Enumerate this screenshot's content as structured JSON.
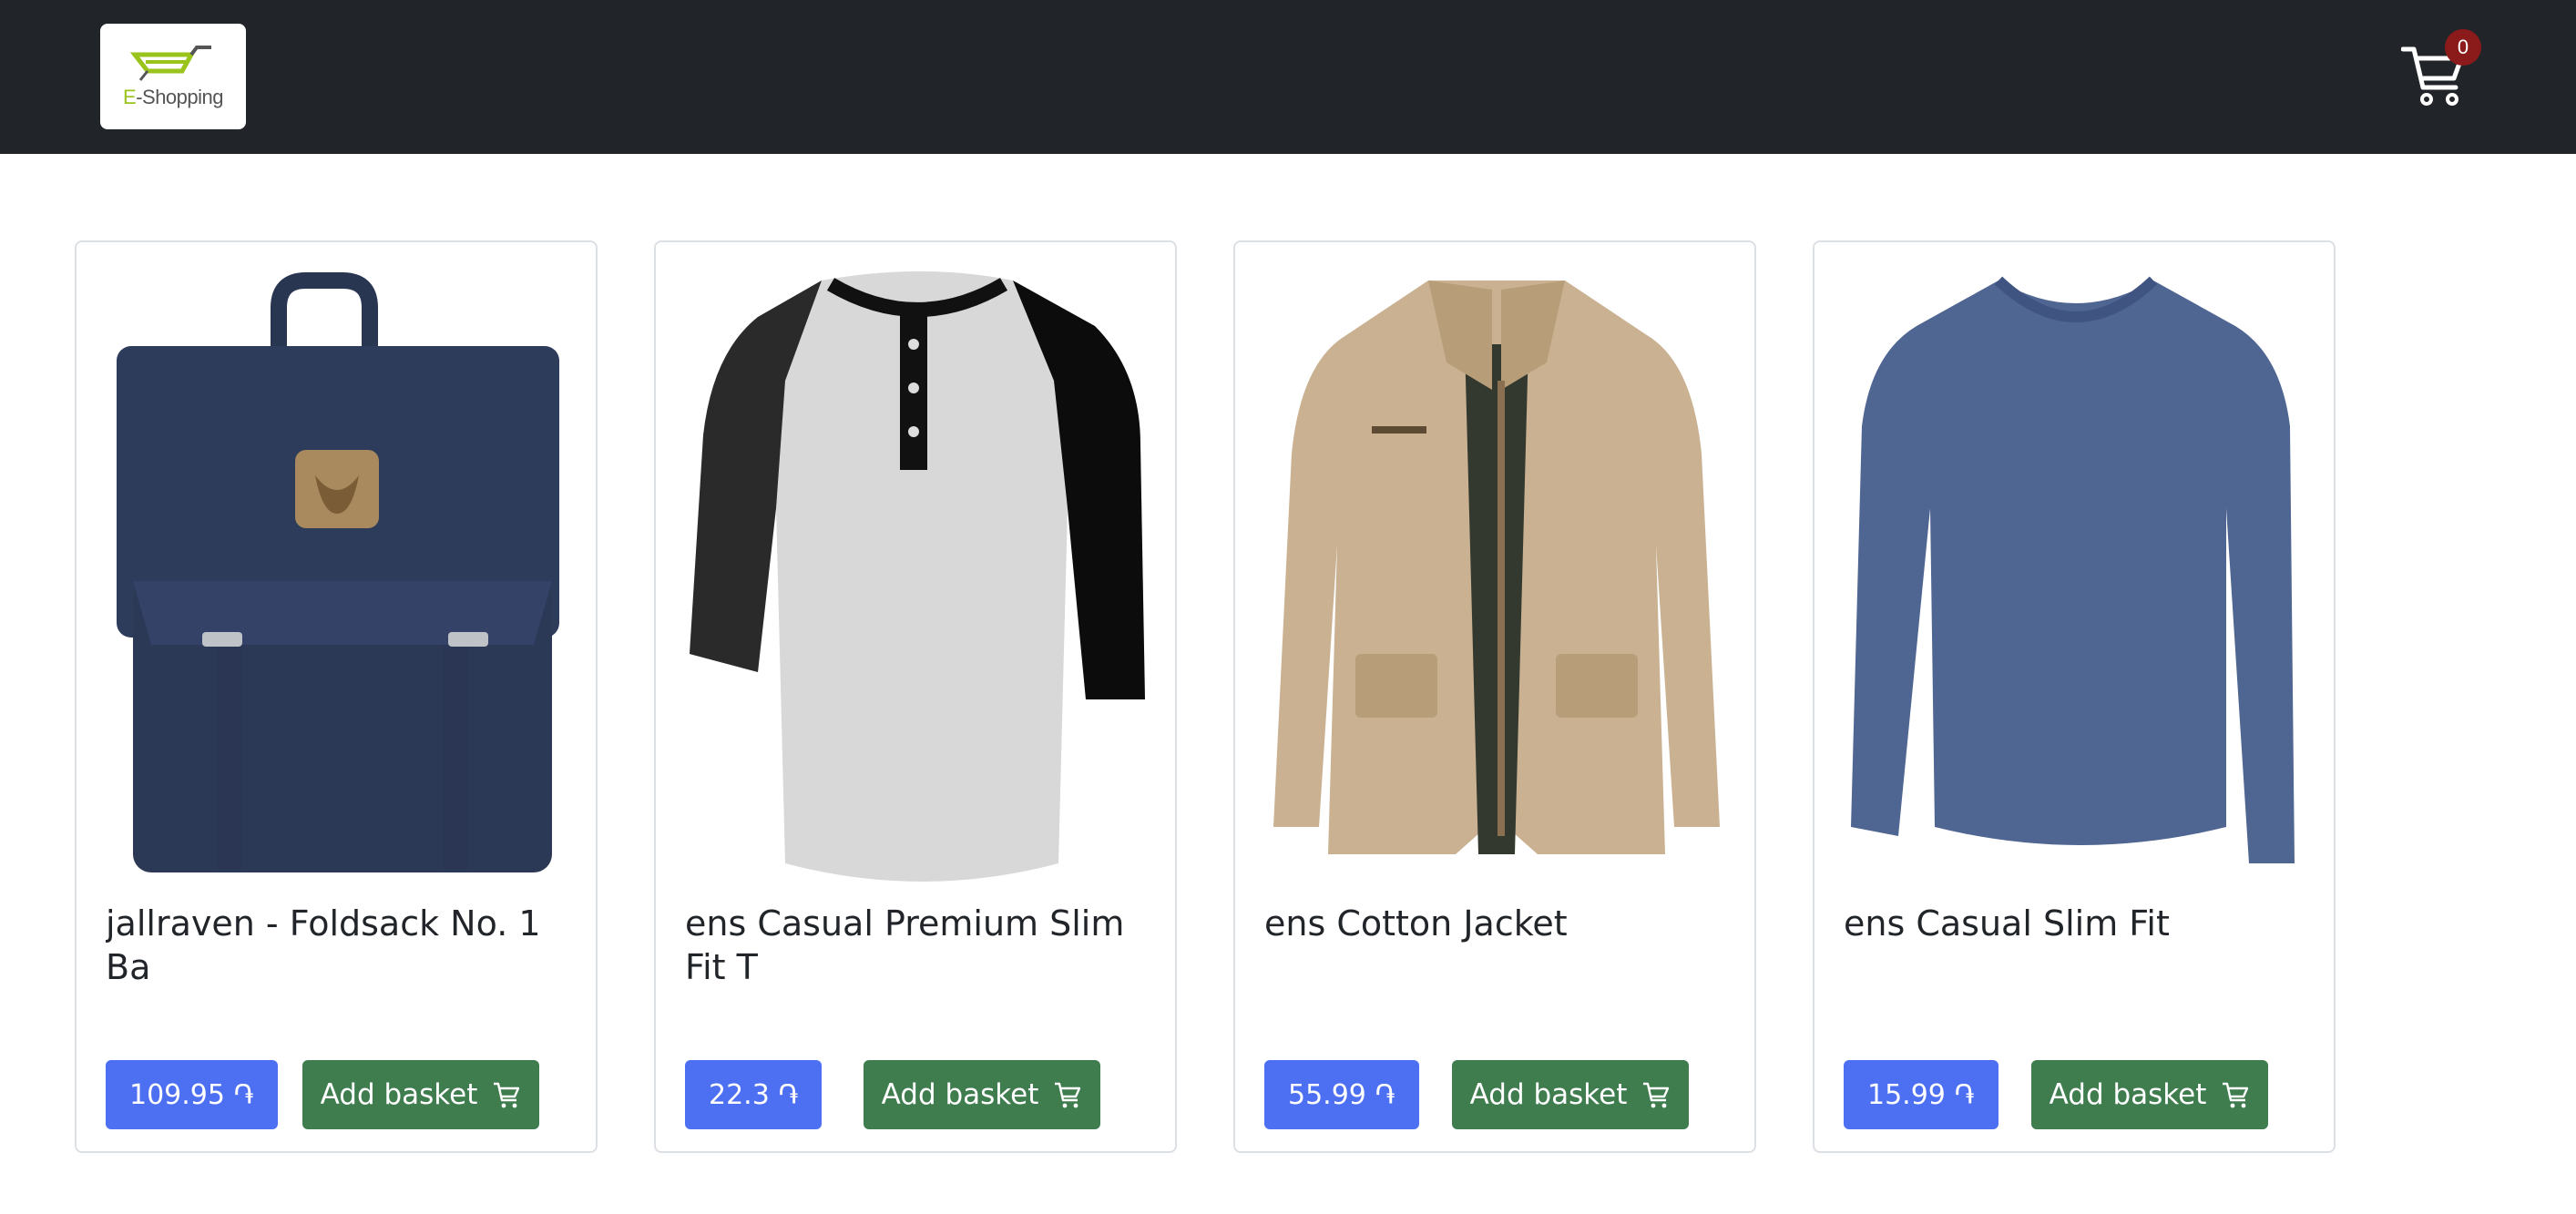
{
  "header": {
    "logo_text_e": "E",
    "logo_text_rest": "-Shopping",
    "cart_count": "0"
  },
  "products": [
    {
      "title": "jallraven - Foldsack No. 1 Ba",
      "price": "109.95",
      "currency": "֏",
      "add_label": "Add basket",
      "image": "navy-backpack"
    },
    {
      "title": "ens Casual Premium Slim Fit T",
      "price": "22.3",
      "currency": "֏",
      "add_label": "Add basket",
      "image": "raglan-henley-shirt"
    },
    {
      "title": "ens Cotton Jacket",
      "price": "55.99",
      "currency": "֏",
      "add_label": "Add basket",
      "image": "khaki-cotton-jacket"
    },
    {
      "title": "ens Casual Slim Fit",
      "price": "15.99",
      "currency": "֏",
      "add_label": "Add basket",
      "image": "blue-longsleeve-tee"
    }
  ],
  "colors": {
    "navbar": "#212529",
    "price_button": "#4d6ff2",
    "add_button": "#3f7d4f",
    "badge": "#8b1a1a"
  }
}
